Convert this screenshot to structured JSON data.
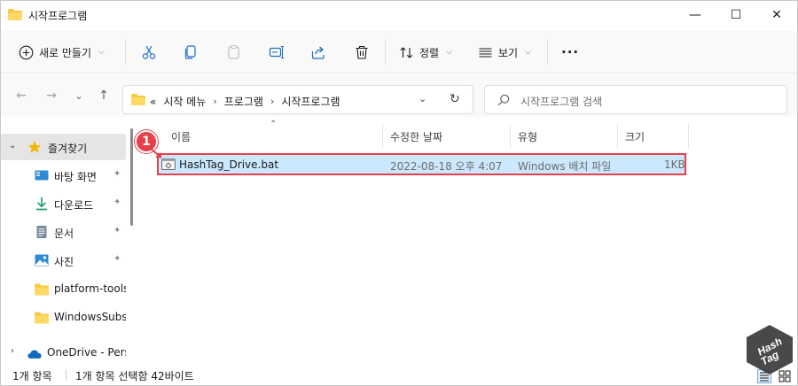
{
  "window": {
    "title": "시작프로그램",
    "minimize_glyph": "—",
    "maximize_glyph": "☐",
    "close_glyph": "✕"
  },
  "toolbar": {
    "new_label": "새로 만들기",
    "sort_label": "정렬",
    "view_label": "보기",
    "more_label": "···",
    "dropdown_glyph": "⌵"
  },
  "navigation": {
    "back_glyph": "←",
    "forward_glyph": "→",
    "recent_glyph": "⌄",
    "up_glyph": "↑"
  },
  "address": {
    "overflow": "«",
    "separator": "›",
    "crumbs": [
      "시작 메뉴",
      "프로그램",
      "시작프로그램"
    ],
    "dropdown_glyph": "⌄",
    "refresh_glyph": "↻"
  },
  "search": {
    "placeholder": "시작프로그램 검색"
  },
  "sidebar": {
    "quick_access": "즐겨찾기",
    "items": [
      {
        "label": "바탕 화면",
        "icon": "desktop-icon",
        "pinned": true
      },
      {
        "label": "다운로드",
        "icon": "download-icon",
        "pinned": true
      },
      {
        "label": "문서",
        "icon": "document-icon",
        "pinned": true
      },
      {
        "label": "사진",
        "icon": "pictures-icon",
        "pinned": true
      },
      {
        "label": "platform-tools",
        "icon": "folder-icon",
        "pinned": false
      },
      {
        "label": "WindowsSubsy",
        "icon": "folder-icon",
        "pinned": false
      }
    ],
    "onedrive": "OneDrive - Perso",
    "pin_glyph": "📌",
    "expand_open": "⌄",
    "expand_closed": "›"
  },
  "columns": {
    "name": "이름",
    "date": "수정한 날짜",
    "type": "유형",
    "size": "크기",
    "sort_glyph": "⌃"
  },
  "files": [
    {
      "name": "HashTag_Drive.bat",
      "date": "2022-08-18 오후 4:07",
      "type": "Windows 배치 파일",
      "size": "1KB"
    }
  ],
  "annotation": {
    "badge": "1",
    "color": "#e8404a"
  },
  "status": {
    "count": "1개 항목",
    "selection": "1개 항목 선택함 42바이트"
  },
  "watermark": {
    "text_line1": "Hash",
    "text_line2": "Tag"
  },
  "colors": {
    "accent": "#0067c0",
    "selection": "#cce8ff",
    "folder": "#f8c945"
  }
}
